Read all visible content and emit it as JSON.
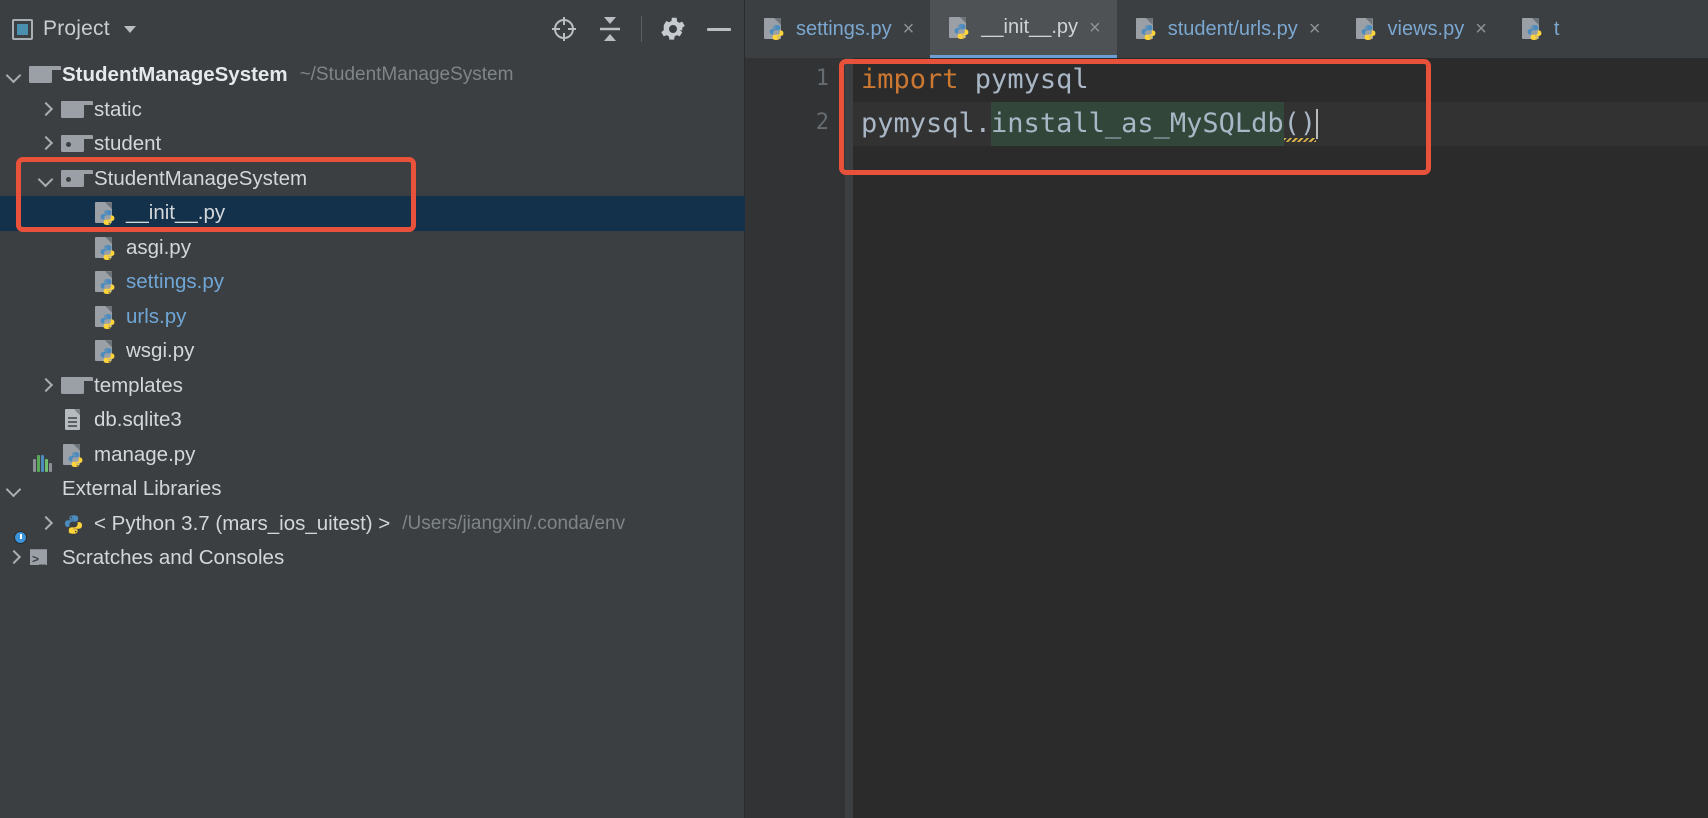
{
  "sidebar": {
    "title": "Project",
    "icons": {
      "panel": "project-panel-icon",
      "dropdown": "chevron-down-icon",
      "locate": "locate-file-icon",
      "collapse": "collapse-all-icon",
      "settings": "gear-icon",
      "minimize": "minimize-icon"
    },
    "tree": [
      {
        "label": "StudentManageSystem",
        "sub": "~/StudentManageSystem",
        "icon": "folder-icon",
        "arrow": "down",
        "indent": 0,
        "style": "bold",
        "selected": false
      },
      {
        "label": "static",
        "sub": "",
        "icon": "folder-icon",
        "arrow": "right",
        "indent": 1,
        "style": "normal",
        "selected": false
      },
      {
        "label": "student",
        "sub": "",
        "icon": "folder-module-icon",
        "arrow": "right",
        "indent": 1,
        "style": "normal",
        "selected": false
      },
      {
        "label": "StudentManageSystem",
        "sub": "",
        "icon": "folder-module-icon",
        "arrow": "down",
        "indent": 1,
        "style": "normal",
        "selected": false
      },
      {
        "label": "__init__.py",
        "sub": "",
        "icon": "python-file-icon",
        "arrow": "none",
        "indent": 2,
        "style": "normal",
        "selected": true
      },
      {
        "label": "asgi.py",
        "sub": "",
        "icon": "python-file-icon",
        "arrow": "none",
        "indent": 2,
        "style": "normal",
        "selected": false
      },
      {
        "label": "settings.py",
        "sub": "",
        "icon": "python-file-icon",
        "arrow": "none",
        "indent": 2,
        "style": "blue",
        "selected": false
      },
      {
        "label": "urls.py",
        "sub": "",
        "icon": "python-file-icon",
        "arrow": "none",
        "indent": 2,
        "style": "blue",
        "selected": false
      },
      {
        "label": "wsgi.py",
        "sub": "",
        "icon": "python-file-icon",
        "arrow": "none",
        "indent": 2,
        "style": "normal",
        "selected": false
      },
      {
        "label": "templates",
        "sub": "",
        "icon": "folder-icon",
        "arrow": "right",
        "indent": 1,
        "style": "normal",
        "selected": false
      },
      {
        "label": "db.sqlite3",
        "sub": "",
        "icon": "db-file-icon",
        "arrow": "none",
        "indent": 1,
        "style": "normal",
        "selected": false
      },
      {
        "label": "manage.py",
        "sub": "",
        "icon": "python-file-icon",
        "arrow": "none",
        "indent": 1,
        "style": "normal",
        "selected": false
      },
      {
        "label": "External Libraries",
        "sub": "",
        "icon": "external-libraries-icon",
        "arrow": "down",
        "indent": 0,
        "style": "normal",
        "selected": false
      },
      {
        "label": "< Python 3.7 (mars_ios_uitest) >",
        "sub": "/Users/jiangxin/.conda/env",
        "icon": "python-interpreter-icon",
        "arrow": "right",
        "indent": 1,
        "style": "normal",
        "selected": false
      },
      {
        "label": "Scratches and Consoles",
        "sub": "",
        "icon": "scratches-icon",
        "arrow": "right",
        "indent": 0,
        "style": "normal",
        "selected": false
      }
    ]
  },
  "editor": {
    "tabs": [
      {
        "label": "settings.py",
        "icon": "python-file-icon",
        "active": false,
        "closable": true
      },
      {
        "label": "__init__.py",
        "icon": "python-file-icon",
        "active": true,
        "closable": true
      },
      {
        "label": "student/urls.py",
        "icon": "python-file-icon",
        "active": false,
        "closable": true
      },
      {
        "label": "views.py",
        "icon": "python-file-icon",
        "active": false,
        "closable": true
      },
      {
        "label": "t",
        "icon": "python-file-icon",
        "active": false,
        "closable": false
      }
    ],
    "line_numbers": [
      "1",
      "2"
    ],
    "code": {
      "line1_keyword": "import",
      "line1_rest": " pymysql",
      "line2_prefix": "pymysql.",
      "line2_usage": "install_as_MySQLdb",
      "line2_suffix": "()"
    }
  },
  "annotations": [
    {
      "name": "tree-highlight-box",
      "color": "#e8513a"
    },
    {
      "name": "code-highlight-box",
      "color": "#e8513a"
    }
  ],
  "colors": {
    "sidebar_bg": "#3c3f41",
    "editor_bg": "#2b2b2b",
    "gutter_bg": "#313335",
    "selection_bg": "#14314b",
    "accent_red": "#e8513a",
    "keyword_orange": "#cc7832",
    "link_blue": "#6fa6d6",
    "usage_green": "#32463a",
    "text": "#a9b7c6"
  }
}
